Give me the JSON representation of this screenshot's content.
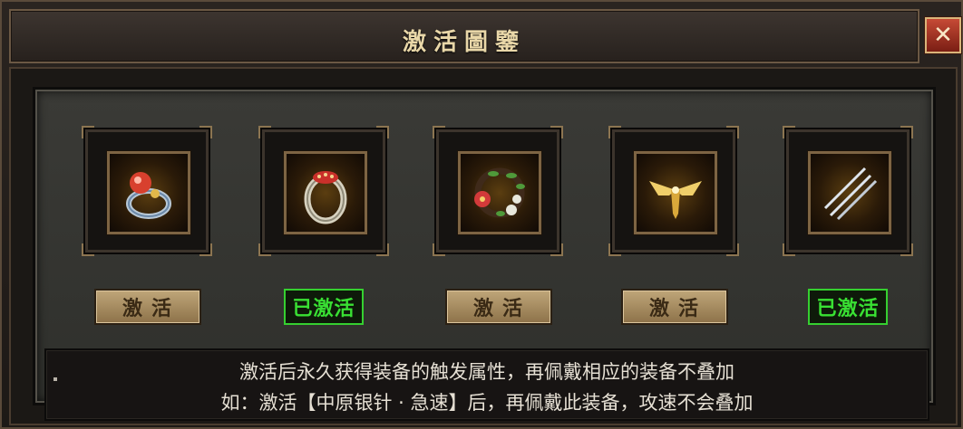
{
  "window": {
    "title": "激活圖鑒",
    "close_glyph": "✕"
  },
  "items": [
    {
      "icon": "ruby-ring-icon",
      "status": "inactive",
      "button_label": "激活"
    },
    {
      "icon": "jeweled-ring-icon",
      "status": "active",
      "button_label": "已激活"
    },
    {
      "icon": "flower-wreath-icon",
      "status": "inactive",
      "button_label": "激活"
    },
    {
      "icon": "golden-wings-pendant-icon",
      "status": "inactive",
      "button_label": "激活"
    },
    {
      "icon": "silver-needles-icon",
      "status": "active",
      "button_label": "已激活"
    }
  ],
  "description": {
    "line1": "激活后永久获得装备的触发属性，再佩戴相应的装备不叠加",
    "line2": "如：激活【中原银针 · 急速】后，再佩戴此装备，攻速不会叠加"
  },
  "colors": {
    "active_green": "#39e033",
    "inactive_button": "#bfa679",
    "title_text": "#e9d7a8"
  }
}
